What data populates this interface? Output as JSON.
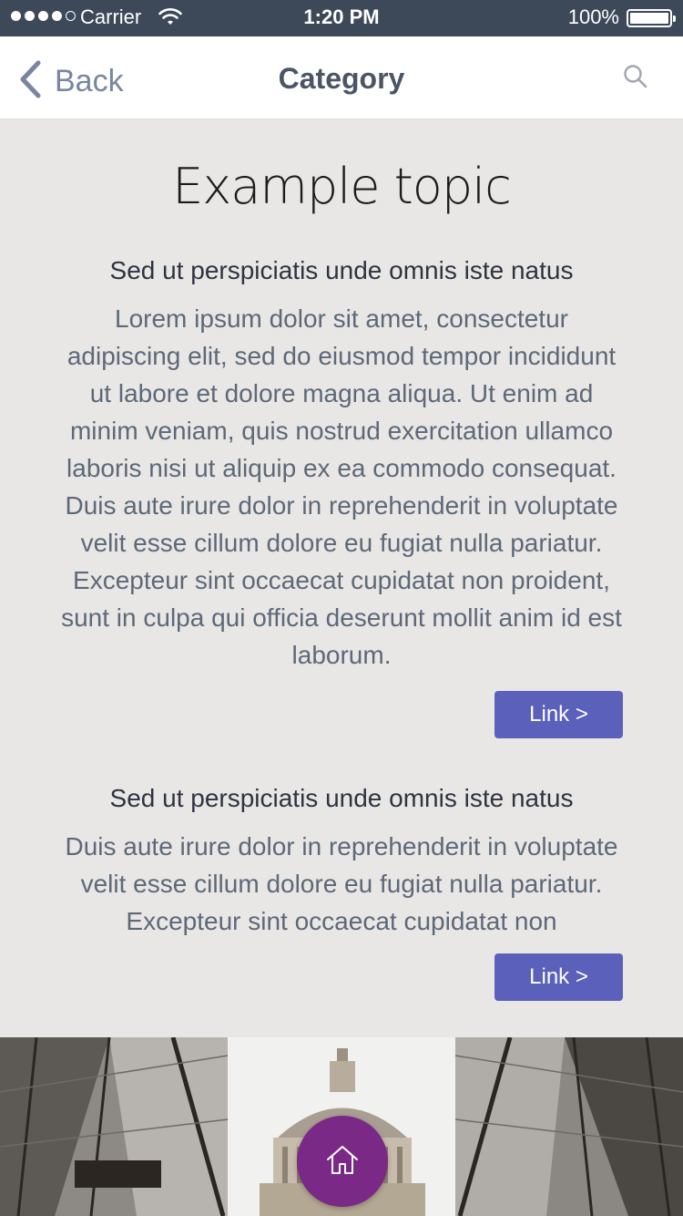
{
  "status_bar": {
    "carrier": "Carrier",
    "time": "1:20 PM",
    "battery": "100%"
  },
  "nav": {
    "back_label": "Back",
    "title": "Category",
    "icons": {
      "back": "chevron-left-icon",
      "search": "search-icon"
    }
  },
  "page": {
    "title": "Example topic"
  },
  "sections": [
    {
      "heading": "Sed ut perspiciatis unde omnis iste natus",
      "body": "Lorem ipsum dolor sit amet, consectetur adipiscing elit, sed do eiusmod tempor incididunt ut labore et dolore magna aliqua. Ut enim ad minim veniam, quis nostrud exercitation ullamco laboris nisi ut aliquip ex ea commodo consequat. Duis aute irure dolor in reprehenderit in voluptate velit esse cillum dolore eu fugiat nulla pariatur. Excepteur sint occaecat cupidatat non proident, sunt in culpa qui officia deserunt mollit anim id est laborum.",
      "link_label": "Link >"
    },
    {
      "heading": "Sed ut perspiciatis unde omnis iste natus",
      "body": "Duis aute irure dolor in reprehenderit in voluptate velit esse cillum dolore eu fugiat nulla pariatur. Excepteur sint occaecat cupidatat non",
      "link_label": "Link >"
    }
  ],
  "home_button": {
    "icon": "home-icon"
  },
  "colors": {
    "status_bar": "#3d4859",
    "accent": "#5b61bb",
    "fab": "#7a2a86",
    "background": "#e9e7e5"
  }
}
